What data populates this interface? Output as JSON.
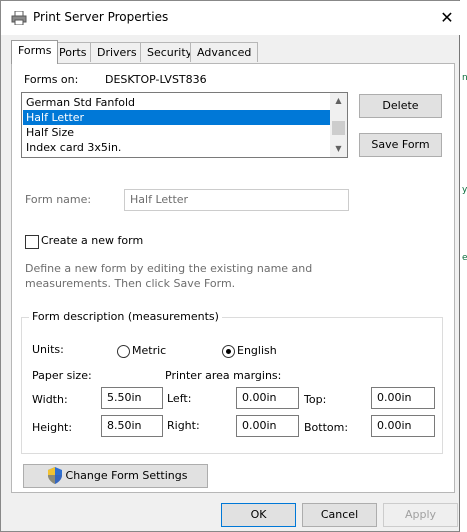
{
  "window": {
    "title": "Print Server Properties",
    "close_glyph": "✕"
  },
  "tabs": [
    {
      "label": "Forms",
      "active": true
    },
    {
      "label": "Ports"
    },
    {
      "label": "Drivers"
    },
    {
      "label": "Security"
    },
    {
      "label": "Advanced"
    }
  ],
  "forms": {
    "forms_on_label": "Forms on:",
    "server_name": "DESKTOP-LVST836",
    "list_items": [
      "German Std Fanfold",
      "Half Letter",
      "Half Size",
      "Index card 3x5in."
    ],
    "selected_index": 1,
    "delete_label": "Delete",
    "save_form_label": "Save Form",
    "form_name_label": "Form name:",
    "form_name_value": "Half Letter",
    "create_new_label": "Create a new form",
    "create_new_checked": false,
    "help_text_line1": "Define a new form by editing the existing name and",
    "help_text_line2": "measurements. Then click Save Form."
  },
  "description": {
    "group_title": "Form description (measurements)",
    "units_label": "Units:",
    "metric_label": "Metric",
    "english_label": "English",
    "selected_unit": "English",
    "paper_size_label": "Paper size:",
    "margins_label": "Printer area margins:",
    "width_label": "Width:",
    "width_value": "5.50in",
    "height_label": "Height:",
    "height_value": "8.50in",
    "left_label": "Left:",
    "left_value": "0.00in",
    "right_label": "Right:",
    "right_value": "0.00in",
    "top_label": "Top:",
    "top_value": "0.00in",
    "bottom_label": "Bottom:",
    "bottom_value": "0.00in"
  },
  "change_settings_label": "Change Form Settings",
  "footer": {
    "ok_label": "OK",
    "cancel_label": "Cancel",
    "apply_label": "Apply"
  },
  "colors": {
    "selection": "#0078d7",
    "dialog_bg": "#f0f0f0",
    "panel_bg": "#ffffff"
  },
  "icons": {
    "app": "printer-icon",
    "shield": "uac-shield-icon"
  }
}
